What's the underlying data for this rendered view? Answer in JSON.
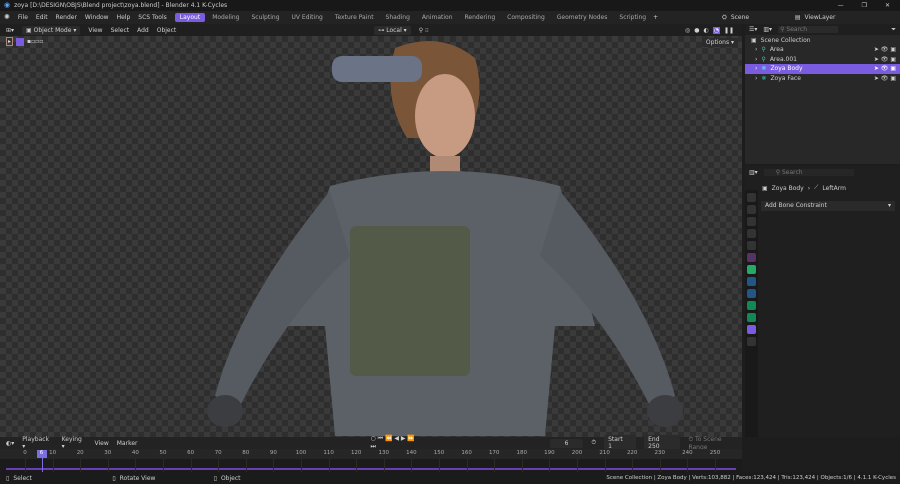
{
  "title": "zoya [D:\\DESIGN\\OBJS\\Blend project\\zoya.blend] - Blender 4.1 K-Cycles",
  "menu": [
    "File",
    "Edit",
    "Render",
    "Window",
    "Help",
    "SCS Tools"
  ],
  "workspaces": [
    "Layout",
    "Modeling",
    "Sculpting",
    "UV Editing",
    "Texture Paint",
    "Shading",
    "Animation",
    "Rendering",
    "Compositing",
    "Geometry Nodes",
    "Scripting"
  ],
  "active_workspace": "Layout",
  "scene": "Scene",
  "view_layer": "ViewLayer",
  "viewport": {
    "mode": "Object Mode",
    "menus": [
      "View",
      "Select",
      "Add",
      "Object"
    ],
    "orientation": "Local",
    "options": "Options"
  },
  "outliner": {
    "search_placeholder": "Search",
    "root": "Scene Collection",
    "items": [
      {
        "name": "Area",
        "selected": false
      },
      {
        "name": "Area.001",
        "selected": false
      },
      {
        "name": "Zoya Body",
        "selected": true
      },
      {
        "name": "Zoya Face",
        "selected": false
      }
    ]
  },
  "properties": {
    "search_placeholder": "Search",
    "breadcrumb_object": "Zoya Body",
    "breadcrumb_bone": "LeftArm",
    "add_constraint": "Add Bone Constraint"
  },
  "timeline": {
    "menus": [
      "Playback",
      "Keying",
      "View",
      "Marker"
    ],
    "current_frame": "6",
    "start_label": "Start",
    "start": "1",
    "end_label": "End",
    "end": "250",
    "to_scene_range": "To Scene Range",
    "ticks": [
      "0",
      "10",
      "20",
      "30",
      "40",
      "50",
      "60",
      "70",
      "80",
      "90",
      "100",
      "110",
      "120",
      "130",
      "140",
      "150",
      "160",
      "170",
      "180",
      "190",
      "200",
      "210",
      "220",
      "230",
      "240",
      "250"
    ]
  },
  "status": {
    "select": "Select",
    "rotate": "Rotate View",
    "object": "Object",
    "info": "Scene Collection | Zoya Body | Verts:103,882 | Faces:123,424 | Tris:123,424 | Objects:1/6 | 4.1.1 K-Cycles"
  },
  "colors": {
    "accent": "#7a5ce0"
  }
}
